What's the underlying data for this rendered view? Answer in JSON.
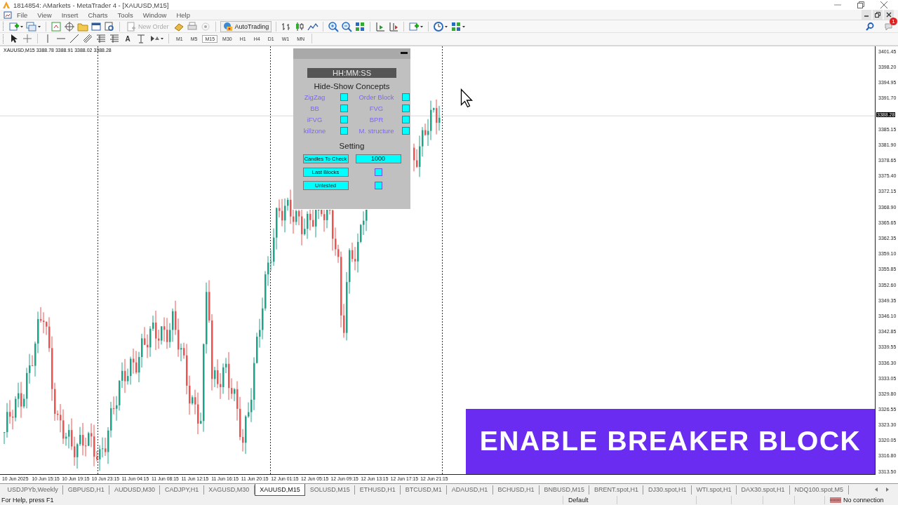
{
  "window": {
    "title": "1814854: AMarkets - MetaTrader 4 - [XAUUSD,M15]"
  },
  "menu": [
    "File",
    "View",
    "Insert",
    "Charts",
    "Tools",
    "Window",
    "Help"
  ],
  "toolbar": {
    "new_order": {
      "label": "New Order",
      "disabled": true
    },
    "autotrading": {
      "label": "AutoTrading"
    },
    "text_tool": "A",
    "notification_badge": "1"
  },
  "timeframes": [
    {
      "label": "M1",
      "selected": false
    },
    {
      "label": "M5",
      "selected": false
    },
    {
      "label": "M15",
      "selected": true
    },
    {
      "label": "M30",
      "selected": false
    },
    {
      "label": "H1",
      "selected": false
    },
    {
      "label": "H4",
      "selected": false
    },
    {
      "label": "D1",
      "selected": false
    },
    {
      "label": "W1",
      "selected": false
    },
    {
      "label": "MN",
      "selected": false
    }
  ],
  "chart": {
    "info": "XAUUSD,M15 3388.78 3388.91 3388.02 3388.28",
    "price_labels": [
      "3401.45",
      "3398.20",
      "3394.95",
      "3391.70",
      "3385.15",
      "3381.90",
      "3378.65",
      "3375.40",
      "3372.15",
      "3368.90",
      "3365.65",
      "3362.35",
      "3359.10",
      "3355.85",
      "3352.60",
      "3349.35",
      "3346.10",
      "3342.85",
      "3339.55",
      "3336.30",
      "3333.05",
      "3329.80",
      "3326.55",
      "3323.30",
      "3320.05",
      "3316.80",
      "3313.50"
    ],
    "current_price": "3388.28",
    "time_labels": [
      "10 Jun 2025",
      "10 Jun 15:15",
      "10 Jun 19:15",
      "10 Jun 23:15",
      "11 Jun 04:15",
      "11 Jun 08:15",
      "11 Jun 12:15",
      "11 Jun 16:15",
      "11 Jun 20:15",
      "12 Jun 01:15",
      "12 Jun 05:15",
      "12 Jun 09:15",
      "12 Jun 13:15",
      "12 Jun 17:15",
      "12 Jun 21:15"
    ]
  },
  "panel": {
    "clock": "HH:MM:SS",
    "concepts_title": "Hide-Show Concepts",
    "concepts": [
      {
        "label": "ZigZag",
        "checked": false
      },
      {
        "label": "Order Block",
        "checked": false
      },
      {
        "label": "BB",
        "checked": false
      },
      {
        "label": "FVG",
        "checked": false
      },
      {
        "label": "iFVG",
        "checked": false
      },
      {
        "label": "BPR",
        "checked": false
      },
      {
        "label": "killzone",
        "checked": false
      },
      {
        "label": "M. structure",
        "checked": false
      }
    ],
    "settings_title": "Setting",
    "settings": [
      {
        "kind": "input",
        "label": "Candles To Check",
        "value": "1000"
      },
      {
        "kind": "checkbox",
        "label": "Last Blocks",
        "checked": false
      },
      {
        "kind": "checkbox",
        "label": "Untested",
        "checked": false
      }
    ]
  },
  "banner": {
    "text": "ENABLE BREAKER BLOCK"
  },
  "tabs": [
    {
      "label": "USDJPYb,Weekly",
      "selected": false
    },
    {
      "label": "GBPUSD,H1",
      "selected": false
    },
    {
      "label": "AUDUSD,M30",
      "selected": false
    },
    {
      "label": "CADJPY,H1",
      "selected": false
    },
    {
      "label": "XAGUSD,M30",
      "selected": false
    },
    {
      "label": "XAUUSD,M15",
      "selected": true
    },
    {
      "label": "SOLUSD,M15",
      "selected": false
    },
    {
      "label": "ETHUSD,H1",
      "selected": false
    },
    {
      "label": "BTCUSD,M1",
      "selected": false
    },
    {
      "label": "ADAUSD,H1",
      "selected": false
    },
    {
      "label": "BCHUSD,H1",
      "selected": false
    },
    {
      "label": "BNBUSD,M15",
      "selected": false
    },
    {
      "label": "BRENT.spot,H1",
      "selected": false
    },
    {
      "label": "DJ30.spot,H1",
      "selected": false
    },
    {
      "label": "WTI.spot,H1",
      "selected": false
    },
    {
      "label": "DAX30.spot,H1",
      "selected": false
    },
    {
      "label": "NDQ100.spot,M5",
      "selected": false
    }
  ],
  "status_bar": {
    "help": "For Help, press F1",
    "profile": "Default",
    "connection": "No connection"
  }
}
